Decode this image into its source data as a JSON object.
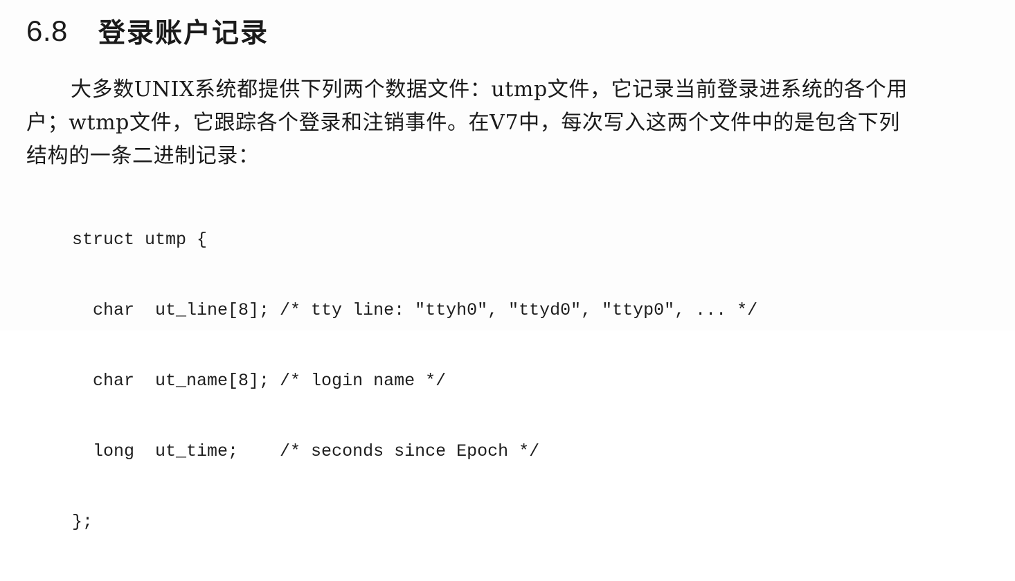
{
  "section": {
    "number": "6.8",
    "title": "登录账户记录"
  },
  "paragraph": {
    "lines": [
      "大多数UNIX系统都提供下列两个数据文件：utmp文件，它记录当前登录进系统的各个用",
      "户；wtmp文件，它跟踪各个登录和注销事件。在V7中，每次写入这两个文件中的是包含下列",
      "结构的一条二进制记录："
    ]
  },
  "code": {
    "lines": [
      "struct utmp {",
      "  char  ut_line[8]; /* tty line: \"ttyh0\", \"ttyd0\", \"ttyp0\", ... */",
      "  char  ut_name[8]; /* login name */",
      "  long  ut_time;    /* seconds since Epoch */",
      "};"
    ]
  }
}
